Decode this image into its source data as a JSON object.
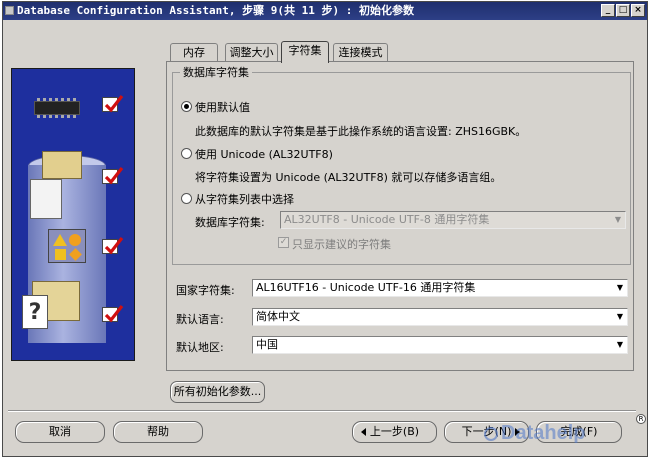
{
  "window": {
    "title": "Database Configuration Assistant, 步骤 9(共 11 步) : 初始化参数",
    "min": "_",
    "max": "□",
    "close": "×"
  },
  "tabs": [
    {
      "label": "内存",
      "active": false
    },
    {
      "label": "调整大小",
      "active": false
    },
    {
      "label": "字符集",
      "active": true
    },
    {
      "label": "连接模式",
      "active": false
    }
  ],
  "charset_group": {
    "legend": "数据库字符集",
    "option_default": {
      "label": "使用默认值",
      "desc": "此数据库的默认字符集是基于此操作系统的语言设置: ZHS16GBK。",
      "selected": true
    },
    "option_unicode": {
      "label": "使用 Unicode (AL32UTF8)",
      "desc": "将字符集设置为 Unicode (AL32UTF8) 就可以存储多语言组。",
      "selected": false
    },
    "option_list": {
      "label": "从字符集列表中选择",
      "selected": false,
      "field_label": "数据库字符集:",
      "field_value": "AL32UTF8 - Unicode UTF-8 通用字符集",
      "checkbox_label": "只显示建议的字符集",
      "checkbox_checked": true
    }
  },
  "national_charset": {
    "label": "国家字符集:",
    "value": "AL16UTF16 - Unicode UTF-16 通用字符集"
  },
  "default_language": {
    "label": "默认语言:",
    "value": "简体中文"
  },
  "default_territory": {
    "label": "默认地区:",
    "value": "中国"
  },
  "buttons": {
    "all_params": "所有初始化参数...",
    "cancel": "取消",
    "help": "帮助",
    "back": "上一步(B)",
    "next": "下一步(N)",
    "finish": "完成(F)"
  },
  "watermark": "Datahelp",
  "icons": [
    "chip-icon",
    "documents-icon",
    "shapes-icon",
    "files-icon",
    "checkmark-icon"
  ],
  "colors": {
    "titlebar": "#1f2f6e",
    "illustration_bg": "#1e2f9e",
    "window_bg": "#d6d3ce",
    "check_red": "#d01010"
  }
}
